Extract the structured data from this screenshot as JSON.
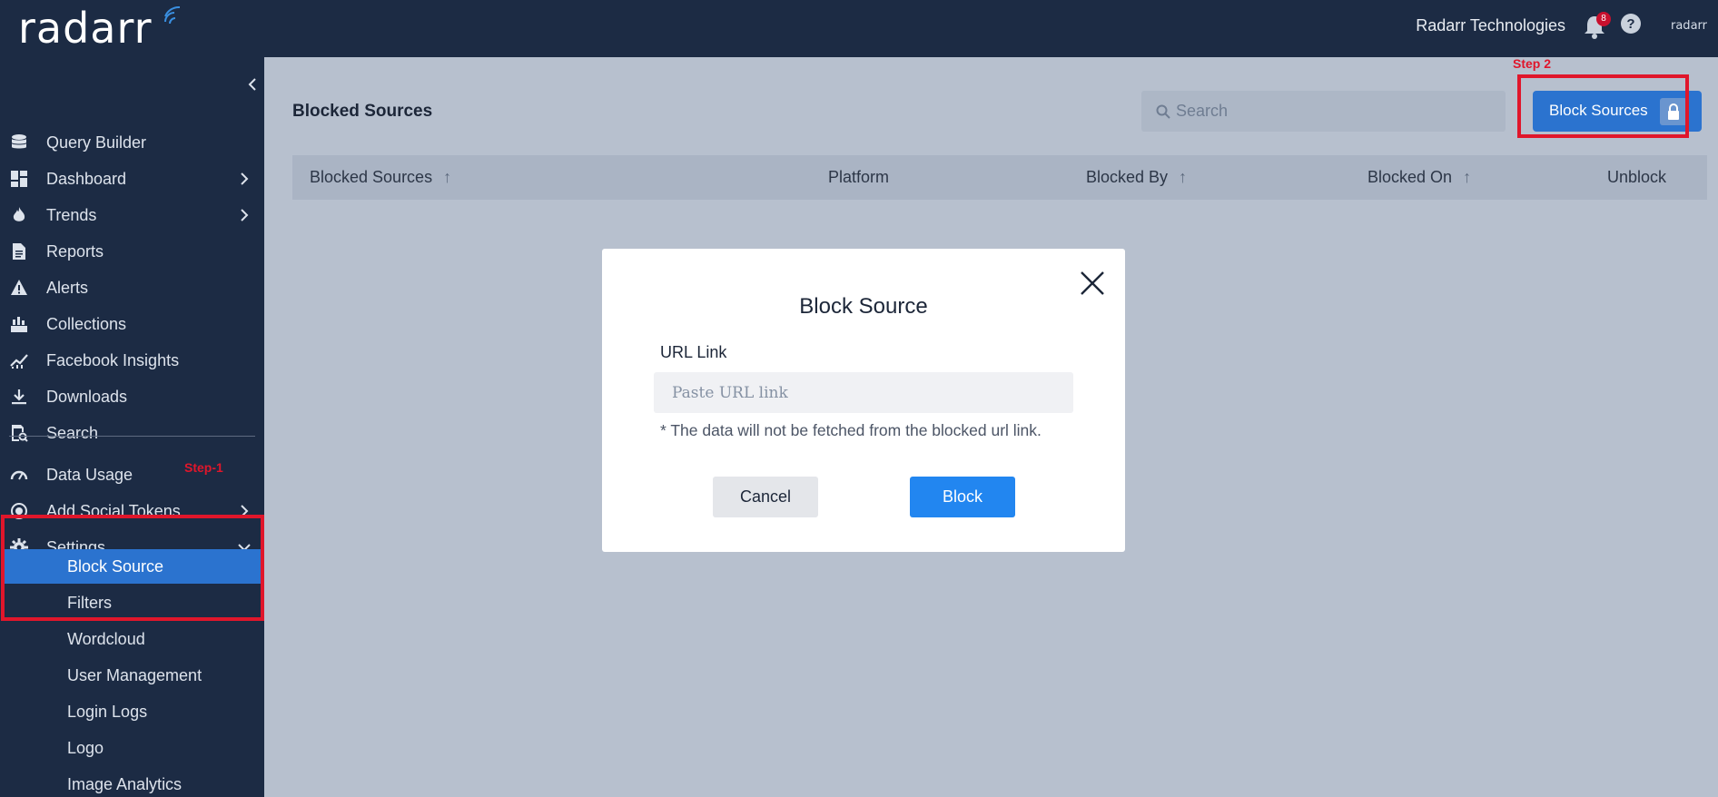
{
  "header": {
    "logo_text": "radarr",
    "company": "Radarr Technologies",
    "notification_count": "8",
    "mini_logo": "radarr"
  },
  "sidebar": {
    "items": [
      {
        "label": "Query Builder",
        "icon": "database-icon"
      },
      {
        "label": "Dashboard",
        "icon": "dashboard-icon",
        "expandable": true
      },
      {
        "label": "Trends",
        "icon": "fire-icon",
        "expandable": true
      },
      {
        "label": "Reports",
        "icon": "document-icon"
      },
      {
        "label": "Alerts",
        "icon": "warning-icon"
      },
      {
        "label": "Collections",
        "icon": "collections-icon"
      },
      {
        "label": "Facebook Insights",
        "icon": "chart-line-icon"
      },
      {
        "label": "Downloads",
        "icon": "download-icon"
      },
      {
        "label": "Search",
        "icon": "search-doc-icon"
      },
      {
        "label": "Data Usage",
        "icon": "gauge-icon"
      },
      {
        "label": "Add Social Tokens",
        "icon": "target-icon",
        "expandable": true
      },
      {
        "label": "Settings",
        "icon": "gear-icon",
        "expanded": true
      }
    ],
    "settings_sub": [
      {
        "label": "Block Source",
        "active": true
      },
      {
        "label": "Filters"
      },
      {
        "label": "Wordcloud"
      },
      {
        "label": "User Management"
      },
      {
        "label": "Login Logs"
      },
      {
        "label": "Logo"
      },
      {
        "label": "Image Analytics"
      }
    ],
    "step1_annotation": "Step-1"
  },
  "main": {
    "title": "Blocked Sources",
    "search_placeholder": "Search",
    "block_button": "Block Sources",
    "step2_annotation": "Step 2",
    "columns": [
      "Blocked Sources",
      "Platform",
      "Blocked By",
      "Blocked On",
      "Unblock"
    ]
  },
  "modal": {
    "title": "Block Source",
    "url_label": "URL Link",
    "url_placeholder": "Paste URL link",
    "note": "* The data will not be fetched from the blocked url link.",
    "cancel": "Cancel",
    "block": "Block"
  }
}
